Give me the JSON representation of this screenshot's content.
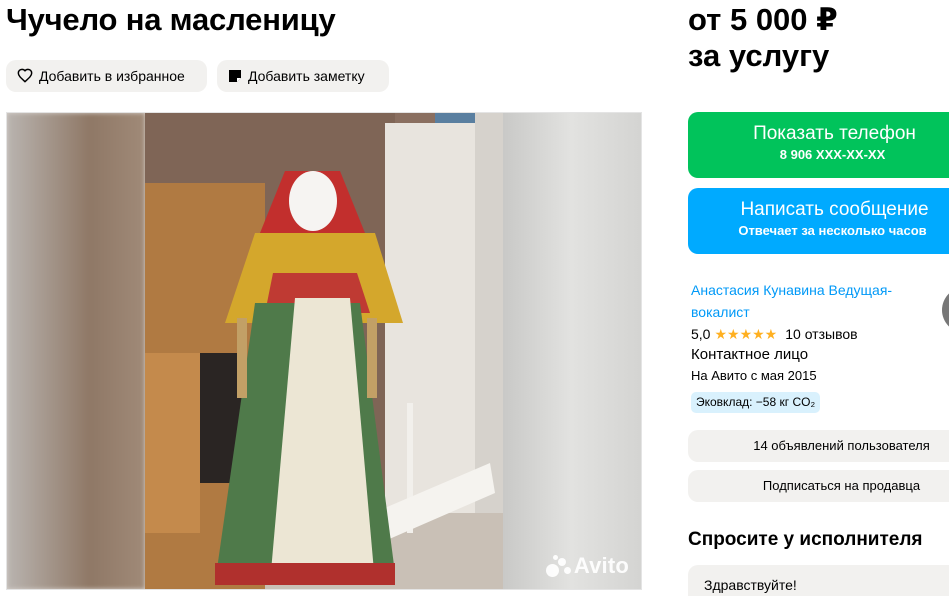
{
  "listing": {
    "title": "Чучело на масленицу",
    "add_favorite_label": "Добавить в избранное",
    "add_note_label": "Добавить заметку",
    "watermark": "Avito"
  },
  "price": {
    "line1": "от 5 000 ₽",
    "line2": "за услугу"
  },
  "actions": {
    "show_phone_label": "Показать телефон",
    "phone_masked": "8 906 XXX-XX-XX",
    "message_label": "Написать сообщение",
    "message_sub": "Отвечает за несколько часов"
  },
  "seller": {
    "name": "Анастасия Кунавина Ведущая-вокалист",
    "rating": "5,0",
    "stars": "★★★★★",
    "reviews": "10 отзывов",
    "role": "Контактное лицо",
    "since": "На Авито с мая 2015",
    "eco": "Эковклад: −58 кг CO₂",
    "ads_link": "14 объявлений пользователя",
    "subscribe": "Подписаться на продавца"
  },
  "ask": {
    "title": "Спросите у исполнителя",
    "greeting": "Здравствуйте!"
  },
  "colors": {
    "green": "#01c35b",
    "blue": "#00aaff",
    "link": "#0099f7",
    "star": "#ffb021"
  }
}
